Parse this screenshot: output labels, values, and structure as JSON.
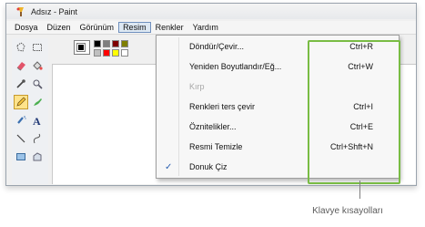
{
  "window": {
    "title": "Adsız - Paint"
  },
  "menubar": {
    "items": [
      {
        "label": "Dosya"
      },
      {
        "label": "Düzen"
      },
      {
        "label": "Görünüm"
      },
      {
        "label": "Resim",
        "active": true
      },
      {
        "label": "Renkler"
      },
      {
        "label": "Yardım"
      }
    ]
  },
  "dropdown": {
    "items": [
      {
        "label": "Döndür/Çevir...",
        "shortcut": "Ctrl+R",
        "enabled": true,
        "checked": false
      },
      {
        "label": "Yeniden Boyutlandır/Eğ...",
        "shortcut": "Ctrl+W",
        "enabled": true,
        "checked": false
      },
      {
        "label": "Kırp",
        "shortcut": "",
        "enabled": false,
        "checked": false
      },
      {
        "label": "Renkleri ters çevir",
        "shortcut": "Ctrl+I",
        "enabled": true,
        "checked": false
      },
      {
        "label": "Öznitelikler...",
        "shortcut": "Ctrl+E",
        "enabled": true,
        "checked": false
      },
      {
        "label": "Resmi Temizle",
        "shortcut": "Ctrl+Shft+N",
        "enabled": true,
        "checked": false
      },
      {
        "label": "Donuk Çiz",
        "shortcut": "",
        "enabled": true,
        "checked": true,
        "check_mark": "✓"
      }
    ]
  },
  "palette": {
    "colors": [
      "#000000",
      "#7f7f7f",
      "#7f0000",
      "#7f7f00",
      "#c0c0c0",
      "#ff0000",
      "#ffff00",
      "#ffffff"
    ]
  },
  "callout": {
    "caption": "Klavye kısayolları",
    "highlight_color": "#79bc44"
  },
  "icons": [
    "paint-app-icon",
    "free-select-icon",
    "rect-select-icon",
    "eraser-icon",
    "fill-icon",
    "picker-icon",
    "magnifier-icon",
    "pencil-icon",
    "brush-icon",
    "airbrush-icon",
    "text-icon",
    "line-icon",
    "curve-icon",
    "rectangle-icon",
    "polygon-icon"
  ]
}
